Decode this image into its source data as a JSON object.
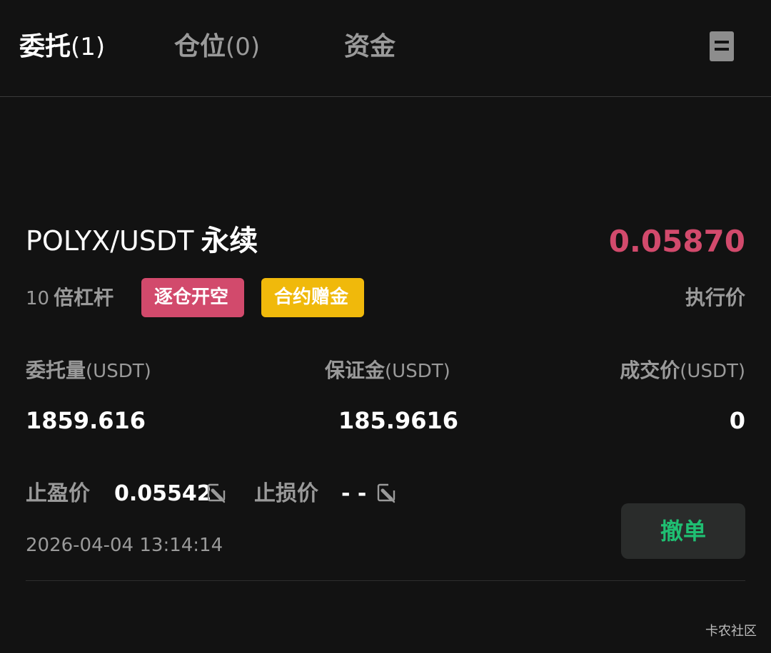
{
  "tabs": [
    {
      "label": "委托",
      "count": "(1)"
    },
    {
      "label": "仓位",
      "count": "(0)"
    },
    {
      "label": "资金",
      "count": ""
    }
  ],
  "icons": {
    "menu": "document-list-icon",
    "edit": "edit-pencil-icon"
  },
  "order": {
    "pair": "POLYX/USDT",
    "type": "永续",
    "price": "0.05870",
    "leverage_num": "10",
    "leverage_text": "倍杠杆",
    "tag_isolated": "逐仓开空",
    "tag_bonus": "合约赠金",
    "exec_label": "执行价",
    "amount_label": "委托量",
    "margin_label": "保证金",
    "fill_label": "成交价",
    "unit": "(USDT)",
    "amount_value": "1859.616",
    "margin_value": "185.9616",
    "fill_value": "0",
    "tp_label": "止盈价",
    "tp_value": "0.05542",
    "sl_label": "止损价",
    "sl_value": "- -",
    "time": "2026-04-04 13:14:14",
    "cancel_label": "撤单"
  },
  "watermark": "卡农社区",
  "colors": {
    "short": "#d24a6c",
    "bonus": "#f0b90b",
    "cancel_text": "#1fbf72"
  }
}
